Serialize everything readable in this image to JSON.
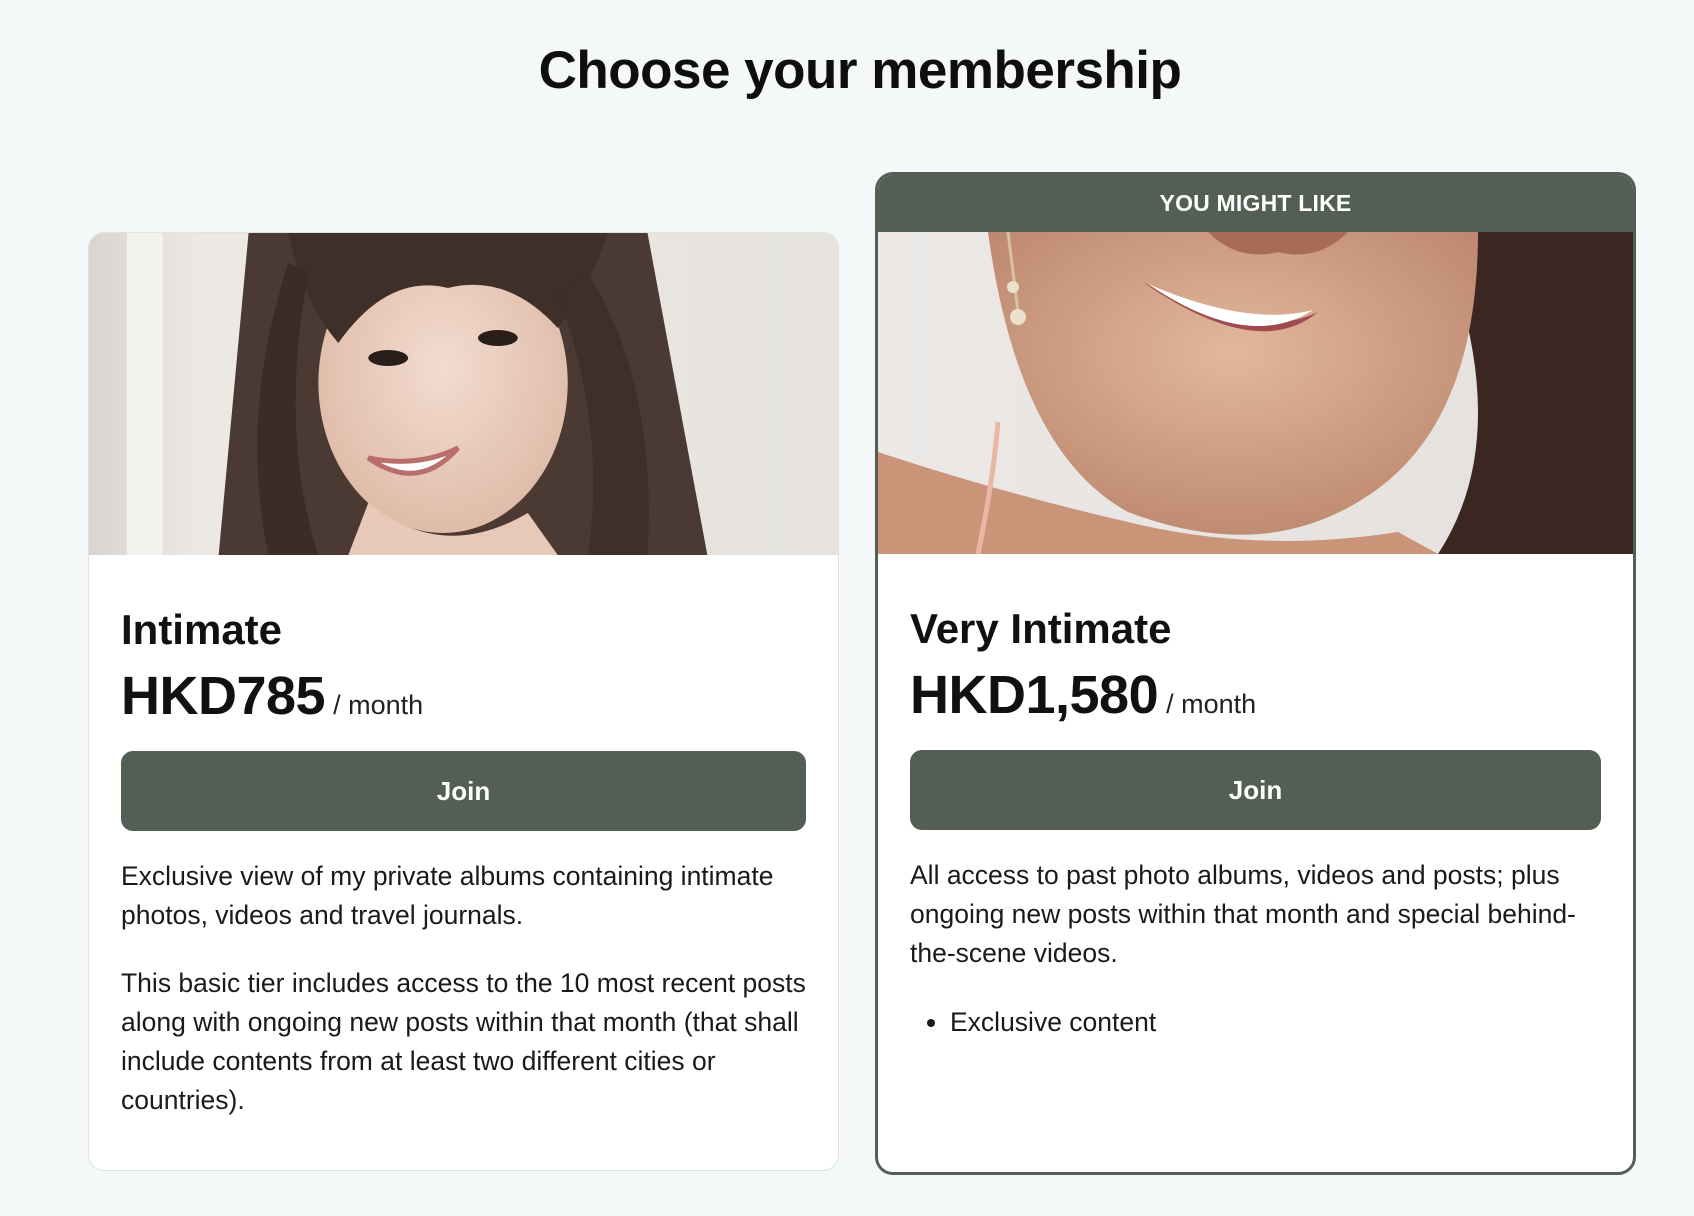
{
  "page": {
    "title": "Choose your membership"
  },
  "tiers": [
    {
      "name": "Intimate",
      "price": "HKD785",
      "period": "/ month",
      "join_label": "Join",
      "description": [
        "Exclusive view of my private albums containing intimate photos, videos and travel journals.",
        "This basic tier includes access to the 10 most recent posts along with ongoing new posts within that month (that shall include contents from at least two different cities or countries)."
      ],
      "benefits": []
    },
    {
      "badge": "YOU MIGHT LIKE",
      "name": "Very Intimate",
      "price": "HKD1,580",
      "period": "/ month",
      "join_label": "Join",
      "description": [
        "All access to past photo albums, videos and posts; plus ongoing new posts within that month and special behind-the-scene videos."
      ],
      "benefits": [
        "Exclusive content"
      ]
    }
  ],
  "colors": {
    "accent": "#535f55",
    "background": "#f5f8f8",
    "card": "#ffffff"
  }
}
